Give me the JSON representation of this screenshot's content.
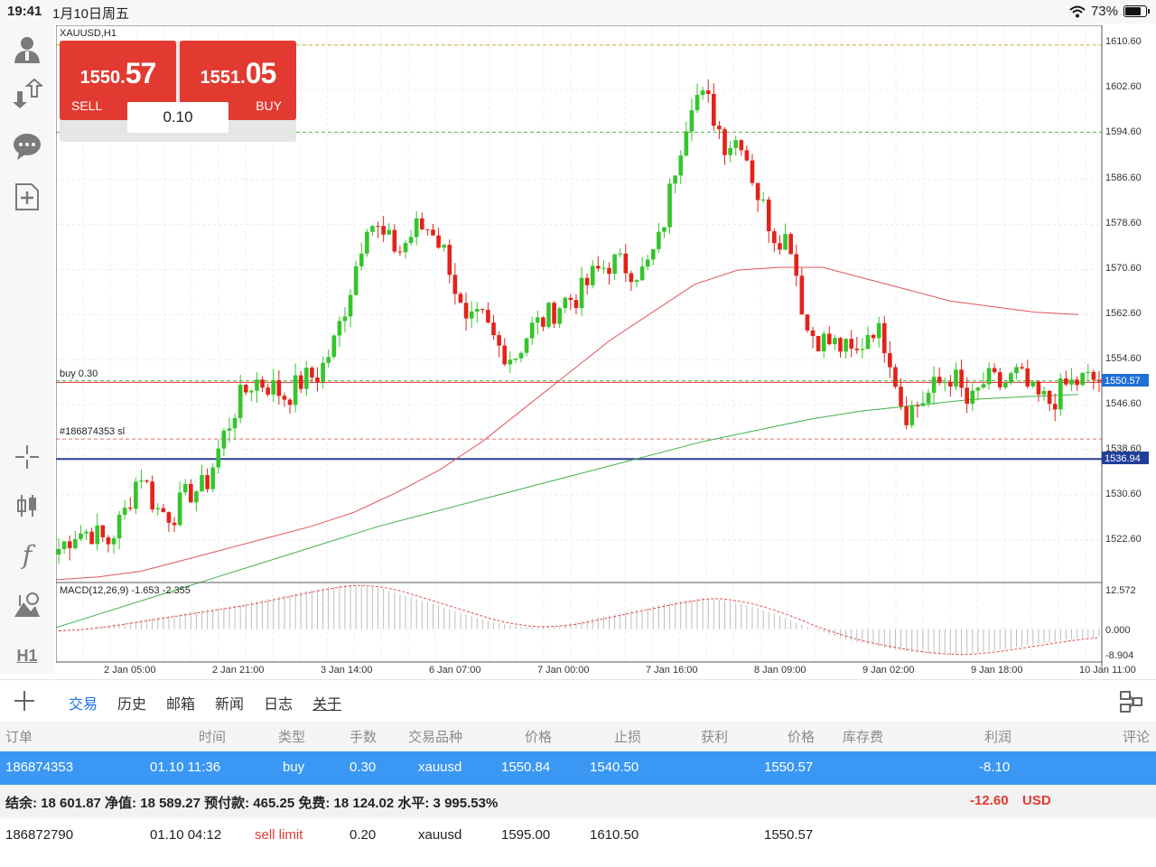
{
  "status_bar": {
    "time": "19:41",
    "date": "1月10日周五",
    "battery": "73%"
  },
  "chart": {
    "symbol_label": "XAUUSD,H1",
    "sl_top_label": "#186874353 sl",
    "buy_label": "buy 0.30",
    "sl_label": "#186874353 sl",
    "macd_label": "MACD(12,26,9) -1.653 -2.355",
    "current_price_tag": "1550.57",
    "blue_line_tag": "1536.94",
    "price_ticks": [
      "1610.60",
      "1602.60",
      "1594.60",
      "1586.60",
      "1578.60",
      "1570.60",
      "1562.60",
      "1554.60",
      "1546.60",
      "1538.60",
      "1530.60",
      "1522.60"
    ],
    "macd_ticks": [
      "12.572",
      "0.000",
      "-8.904"
    ],
    "time_ticks": [
      "2 Jan 05:00",
      "2 Jan 21:00",
      "3 Jan 14:00",
      "6 Jan 07:00",
      "7 Jan 00:00",
      "7 Jan 16:00",
      "8 Jan 09:00",
      "9 Jan 02:00",
      "9 Jan 18:00",
      "10 Jan 11:00"
    ],
    "colors": {
      "up": "#35c52b",
      "down": "#e2231a",
      "ma_red": "#e0555b",
      "ma_green": "#3fb34a",
      "blue_line": "#2c3f9a",
      "price_tag": "#1f6fd6"
    }
  },
  "chart_data": {
    "type": "candlestick",
    "symbol": "XAUUSD",
    "timeframe": "H1",
    "ylim": [
      1515.0,
      1614.0
    ],
    "levels": {
      "take_profit": 1610.5,
      "pending_entry": 1595.0,
      "position_entry": 1550.84,
      "stop_loss": 1540.5,
      "current_bid": 1550.57,
      "blue_line": 1536.94
    },
    "series": [
      {
        "name": "close",
        "anchor_values": [
          1521,
          1524,
          1524,
          1522,
          1527,
          1535,
          1528,
          1527,
          1531,
          1532,
          1540,
          1547,
          1551,
          1550,
          1548,
          1551,
          1552,
          1558,
          1568,
          1580,
          1576,
          1574,
          1578,
          1578,
          1572,
          1560,
          1562,
          1557,
          1555,
          1560,
          1562,
          1565,
          1566,
          1570,
          1572,
          1571,
          1570,
          1576,
          1590,
          1602,
          1600,
          1593,
          1594,
          1584,
          1577,
          1576,
          1560,
          1558,
          1557,
          1555,
          1561,
          1557,
          1545,
          1547,
          1550,
          1552,
          1546,
          1551,
          1550,
          1552,
          1548,
          1547,
          1550,
          1551,
          1551
        ]
      },
      {
        "name": "moving_average_red",
        "anchor_values": [
          1515.5,
          1516,
          1517,
          1519,
          1521,
          1523,
          1525,
          1527.5,
          1531,
          1535,
          1540,
          1546,
          1552,
          1558,
          1563,
          1568,
          1570.5,
          1571,
          1571,
          1569,
          1567,
          1565,
          1564,
          1563,
          1562.6
        ]
      },
      {
        "name": "moving_average_green",
        "anchor_values": [
          1507,
          1510,
          1513,
          1516,
          1519,
          1522,
          1525,
          1527.5,
          1530,
          1532.5,
          1535,
          1537.5,
          1540,
          1542,
          1544,
          1545.5,
          1546.5,
          1547.5,
          1548,
          1548.4
        ]
      },
      {
        "name": "macd",
        "ylim": [
          -8.904,
          12.572
        ],
        "anchor_values": [
          -0.5,
          0.5,
          2,
          3.5,
          5,
          6.5,
          8.5,
          10.5,
          12,
          11,
          8,
          5,
          2,
          0.5,
          1,
          3,
          5,
          7,
          8.5,
          7,
          4,
          0,
          -3,
          -5,
          -6.5,
          -7,
          -6,
          -4.5,
          -3,
          -2
        ]
      }
    ]
  },
  "trade_panel": {
    "sell_price_prefix": "1550.",
    "sell_price_big": "57",
    "sell_label": "SELL",
    "buy_price_prefix": "1551.",
    "buy_price_big": "05",
    "buy_label": "BUY",
    "volume": "0.10"
  },
  "tabs": [
    "交易",
    "历史",
    "邮箱",
    "新闻",
    "日志",
    "关于"
  ],
  "table": {
    "headers": {
      "order": "订单",
      "time": "时间",
      "type": "类型",
      "volume": "手数",
      "symbol": "交易品种",
      "price": "价格",
      "sl": "止损",
      "tp": "获利",
      "current_price": "价格",
      "swap": "库存费",
      "profit": "利润",
      "comment": "评论"
    },
    "position": {
      "order": "186874353",
      "time": "01.10 11:36",
      "type": "buy",
      "volume": "0.30",
      "symbol": "xauusd",
      "price": "1550.84",
      "sl": "1540.50",
      "current_price": "1550.57",
      "profit": "-8.10"
    },
    "summary": {
      "text": "结余:  18 601.87  净值:  18 589.27  预付款:  465.25  免费:  18 124.02  水平:  3 995.53%",
      "profit": "-12.60",
      "currency": "USD"
    },
    "pending": {
      "order": "186872790",
      "time": "01.10 04:12",
      "type": "sell limit",
      "volume": "0.20",
      "symbol": "xauusd",
      "price": "1595.00",
      "sl": "1610.50",
      "current_price": "1550.57"
    }
  }
}
